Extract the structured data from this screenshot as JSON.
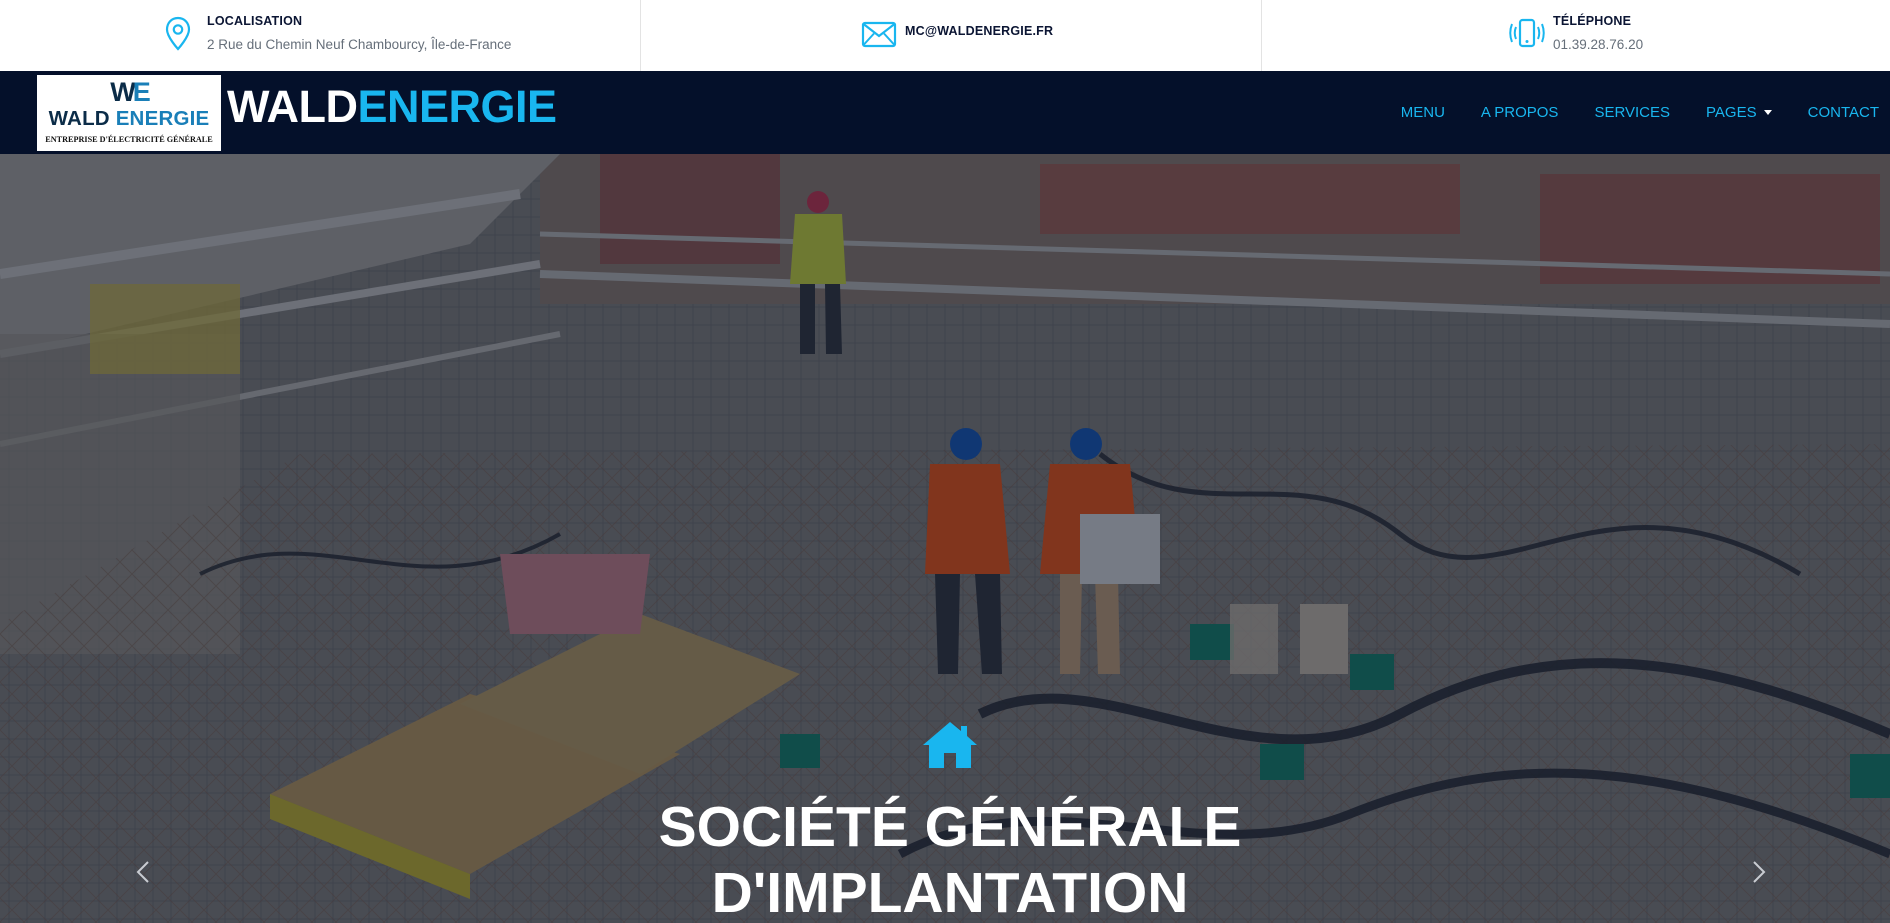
{
  "topbar": {
    "location": {
      "icon": "map-pin-icon",
      "title": "LOCALISATION",
      "text": "2 Rue du Chemin Neuf Chambourcy, Île-de-France"
    },
    "email": {
      "icon": "envelope-icon",
      "title": "MC@WALDENERGIE.FR"
    },
    "phone": {
      "icon": "phone-vibrate-icon",
      "title": "TÉLÉPHONE",
      "text": "01.39.28.76.20"
    }
  },
  "logo": {
    "mark_left": "W",
    "mark_right": "E",
    "name_left": "WALD ",
    "name_right": "ENERGIE",
    "tagline": "ENTREPRISE D'ÉLECTRICITÉ GÉNÉRALE"
  },
  "brand": {
    "part1": "WALD",
    "part2": "ENERGIE"
  },
  "nav": {
    "items": [
      {
        "label": "MENU"
      },
      {
        "label": "A PROPOS"
      },
      {
        "label": "SERVICES"
      },
      {
        "label": "PAGES",
        "dropdown": true
      },
      {
        "label": "CONTACT"
      }
    ]
  },
  "hero": {
    "icon": "home-icon",
    "title_line1": "SOCIÉTÉ GÉNÉRALE",
    "title_line2": "D'IMPLANTATION",
    "prev_icon": "chevron-left-icon",
    "next_icon": "chevron-right-icon"
  },
  "colors": {
    "accent": "#19b6ef",
    "navbar_bg": "#04102a",
    "topbar_title": "#0b1533",
    "topbar_text": "#666f7a"
  }
}
